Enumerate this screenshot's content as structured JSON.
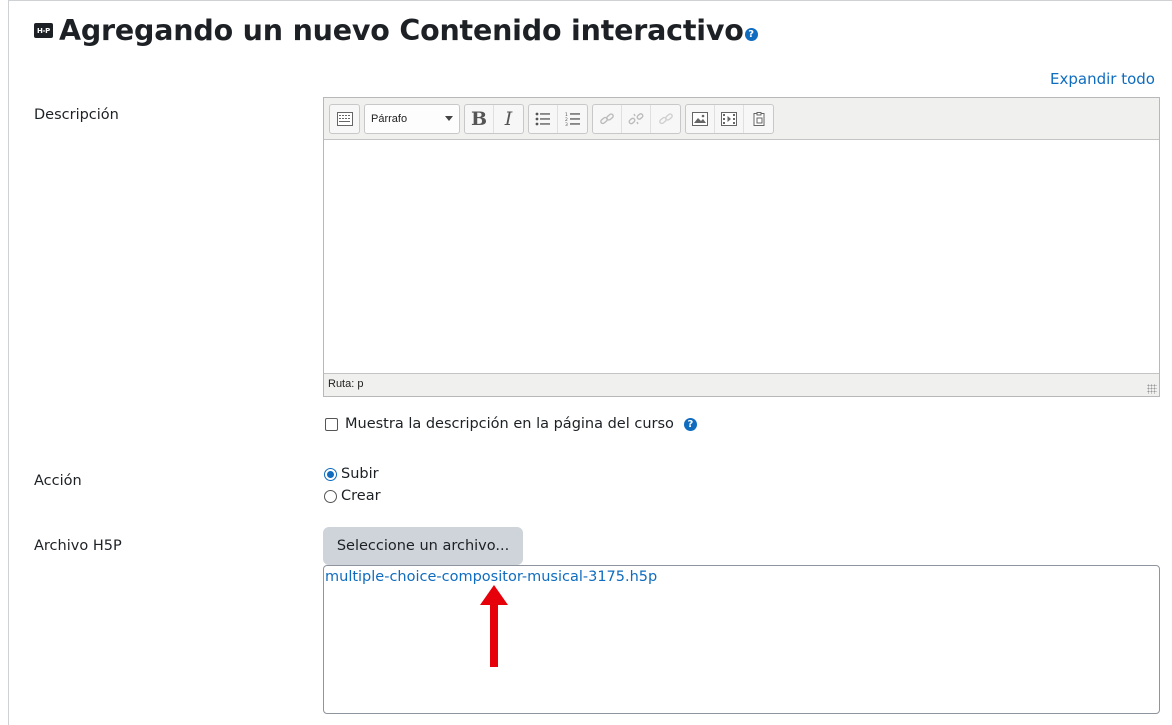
{
  "header": {
    "icon_text": "H-P",
    "title": "Agregando un nuevo Contenido interactivo",
    "help_glyph": "?"
  },
  "expand_all": "Expandir todo",
  "description": {
    "label": "Descripción",
    "format_select": "Párrafo",
    "bold_glyph": "B",
    "italic_glyph": "I",
    "path_text": "Ruta: p",
    "toolbar_icons": [
      "toggle-toolbar-icon",
      "bullet-list-icon",
      "numbered-list-icon",
      "link-icon",
      "unlink-icon",
      "anchor-icon",
      "image-icon",
      "media-icon",
      "paste-icon"
    ]
  },
  "show_description": {
    "label": "Muestra la descripción en la página del curso",
    "checked": false
  },
  "action": {
    "label": "Acción",
    "options": [
      {
        "label": "Subir",
        "checked": true
      },
      {
        "label": "Crear",
        "checked": false
      }
    ]
  },
  "file": {
    "label": "Archivo H5P",
    "button": "Seleccione un archivo...",
    "filename": "multiple-choice-compositor-musical-3175.h5p"
  },
  "colors": {
    "link": "#0f6cbf",
    "annotation_arrow": "#e6000a",
    "button_bg": "#ced4da"
  }
}
